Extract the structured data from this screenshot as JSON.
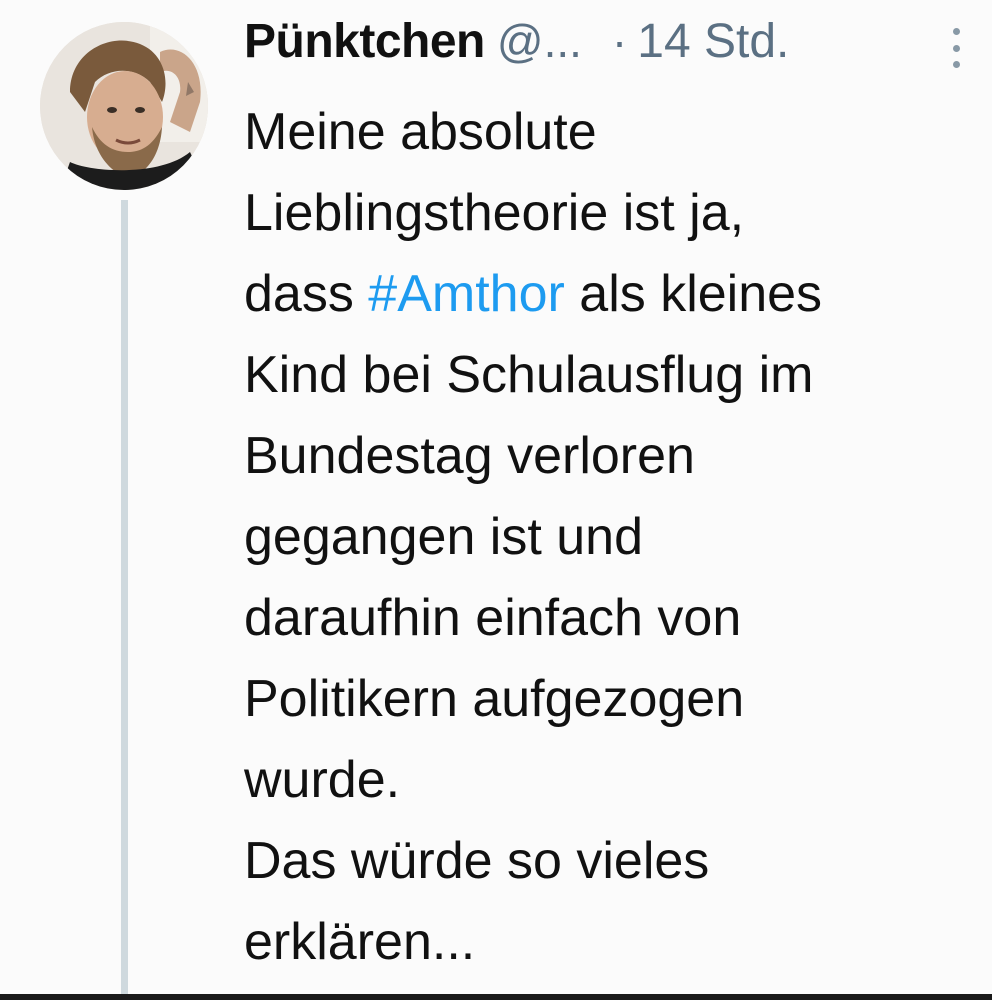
{
  "tweet": {
    "author": {
      "display_name": "Pünktchen",
      "handle": "@...",
      "avatar_icon": "profile-photo-avatar"
    },
    "separator": "·",
    "timestamp": "14 Std.",
    "more_icon": "more-vertical-icon",
    "text": {
      "line1": "Meine absolute",
      "line2": "Lieblingstheorie ist ja,",
      "line3_before": "dass ",
      "hashtag": "#Amthor",
      "line3_after": " als kleines",
      "line4": "Kind bei Schulausflug im",
      "line5": "Bundestag verloren",
      "line6": "gegangen ist und",
      "line7": "daraufhin einfach von",
      "line8": "Politikern aufgezogen",
      "line9": "wurde.",
      "line10": "Das würde so vieles",
      "line11": "erklären..."
    },
    "colors": {
      "hashtag": "#1d9bf0",
      "secondary_text": "#5b7083",
      "thread_line": "#cfd9de"
    }
  }
}
